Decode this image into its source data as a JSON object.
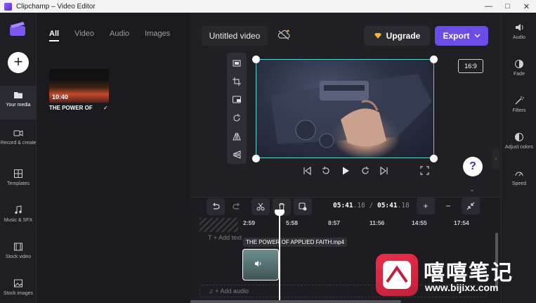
{
  "window": {
    "title": "Clipchamp – Video Editor",
    "minimize": "—",
    "maximize": "□",
    "close": "✕"
  },
  "left_nav": {
    "add_button": "+",
    "items": [
      {
        "label": "Your media",
        "icon": "folder-icon"
      },
      {
        "label": "Record & create",
        "icon": "camera-icon"
      },
      {
        "label": "Templates",
        "icon": "grid-icon"
      },
      {
        "label": "Music & SFX",
        "icon": "music-note-icon"
      },
      {
        "label": "Stock video",
        "icon": "film-icon"
      },
      {
        "label": "Stock images",
        "icon": "image-icon"
      }
    ]
  },
  "media_panel": {
    "tabs": [
      "All",
      "Video",
      "Audio",
      "Images"
    ],
    "active_tab": "All",
    "asset": {
      "duration": "10:40",
      "name": "THE POWER OF",
      "check": "✓"
    }
  },
  "stage": {
    "video_title": "Untitled video",
    "upgrade_label": "Upgrade",
    "export_label": "Export",
    "aspect_ratio": "16:9",
    "help": "?",
    "tools": [
      "fit-icon",
      "crop-icon",
      "pip-icon",
      "rotate-icon",
      "flip-horizontal-icon",
      "flip-vertical-icon"
    ]
  },
  "right_nav": {
    "items": [
      {
        "label": "Audio",
        "icon": "speaker-icon"
      },
      {
        "label": "Fade",
        "icon": "fade-icon"
      },
      {
        "label": "Filters",
        "icon": "wand-icon"
      },
      {
        "label": "Adjust colors",
        "icon": "contrast-icon"
      },
      {
        "label": "Speed",
        "icon": "gauge-icon"
      }
    ]
  },
  "timeline": {
    "current_time": "05:41",
    "current_frac": ".18",
    "separator": "/",
    "total_time": "05:41",
    "total_frac": ".18",
    "ruler_ticks": [
      "2:59",
      "5:58",
      "8:57",
      "11:56",
      "14:55",
      "17:54"
    ],
    "text_track_label": "T  + Add text",
    "clip_tooltip": "THE POWER OF APPLIED FAITH.mp4",
    "audio_track_label": "♫  + Add audio",
    "zoom_in": "+",
    "zoom_out": "−"
  },
  "watermark": {
    "text": "嘻嘻笔记",
    "url": "www.bijixx.com"
  },
  "colors": {
    "accent": "#6b4ce6",
    "selection": "#57d2c8",
    "background": "#1b1b1f"
  }
}
